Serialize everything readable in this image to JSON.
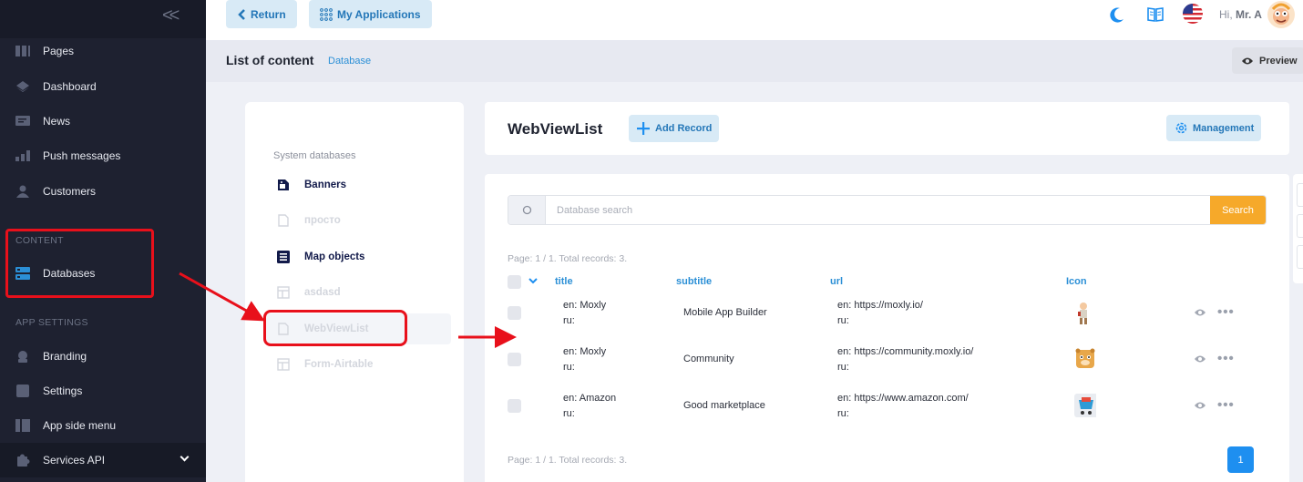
{
  "topbar": {
    "return_label": "Return",
    "my_apps_label": "My Applications",
    "greeting_prefix": "Hi,",
    "user_name": "Mr. A"
  },
  "sidebar": {
    "items_top": [
      {
        "label": "Pages",
        "icon": "pages-icon"
      },
      {
        "label": "Dashboard",
        "icon": "dashboard-icon"
      },
      {
        "label": "News",
        "icon": "news-icon"
      },
      {
        "label": "Push messages",
        "icon": "push-messages-icon"
      },
      {
        "label": "Customers",
        "icon": "customers-icon"
      }
    ],
    "section_content": "CONTENT",
    "databases_label": "Databases",
    "section_app_settings": "APP SETTINGS",
    "items_settings": [
      {
        "label": "Branding",
        "icon": "branding-icon"
      },
      {
        "label": "Settings",
        "icon": "settings-icon"
      },
      {
        "label": "App side menu",
        "icon": "app-side-menu-icon"
      }
    ],
    "services_label": "Services API"
  },
  "header": {
    "title": "List of content",
    "breadcrumb": "Database",
    "preview_label": "Preview"
  },
  "databases_panel": {
    "section_label": "System databases",
    "items": [
      {
        "label": "Banners",
        "style": "dark",
        "icon": "banner-icon"
      },
      {
        "label": "просто",
        "style": "dim",
        "icon": "file-icon"
      },
      {
        "label": "Map objects",
        "style": "dark",
        "icon": "list-icon"
      },
      {
        "label": "asdasd",
        "style": "dim",
        "icon": "table-icon"
      },
      {
        "label": "WebViewList",
        "style": "dim",
        "icon": "file-icon"
      },
      {
        "label": "Form-Airtable",
        "style": "dim",
        "icon": "table-icon"
      }
    ]
  },
  "main": {
    "db_title": "WebViewList",
    "add_record_label": "Add Record",
    "management_label": "Management",
    "search": {
      "placeholder": "Database search",
      "button_label": "Search"
    },
    "page_info_top": "Page: 1 / 1. Total records: 3.",
    "page_info_bottom": "Page: 1 / 1. Total records: 3.",
    "columns": [
      "title",
      "subtitle",
      "url",
      "Icon"
    ],
    "rows": [
      {
        "title_en": "en: Moxly",
        "title_ru": "ru:",
        "subtitle": "Mobile App Builder",
        "url_en": "en: https://moxly.io/",
        "url_ru": "ru:",
        "icon": "cartoon-character-icon"
      },
      {
        "title_en": "en: Moxly",
        "title_ru": "ru:",
        "subtitle": "Community",
        "url_en": "en: https://community.moxly.io/",
        "url_ru": "ru:",
        "icon": "hamster-icon"
      },
      {
        "title_en": "en: Amazon",
        "title_ru": "ru:",
        "subtitle": "Good marketplace",
        "url_en": "en: https://www.amazon.com/",
        "url_ru": "ru:",
        "icon": "shopping-cart-icon"
      }
    ],
    "current_page": "1"
  },
  "colors": {
    "accent": "#2b8fd6",
    "search_button": "#f6a92a",
    "annotation": "#e8101b"
  }
}
